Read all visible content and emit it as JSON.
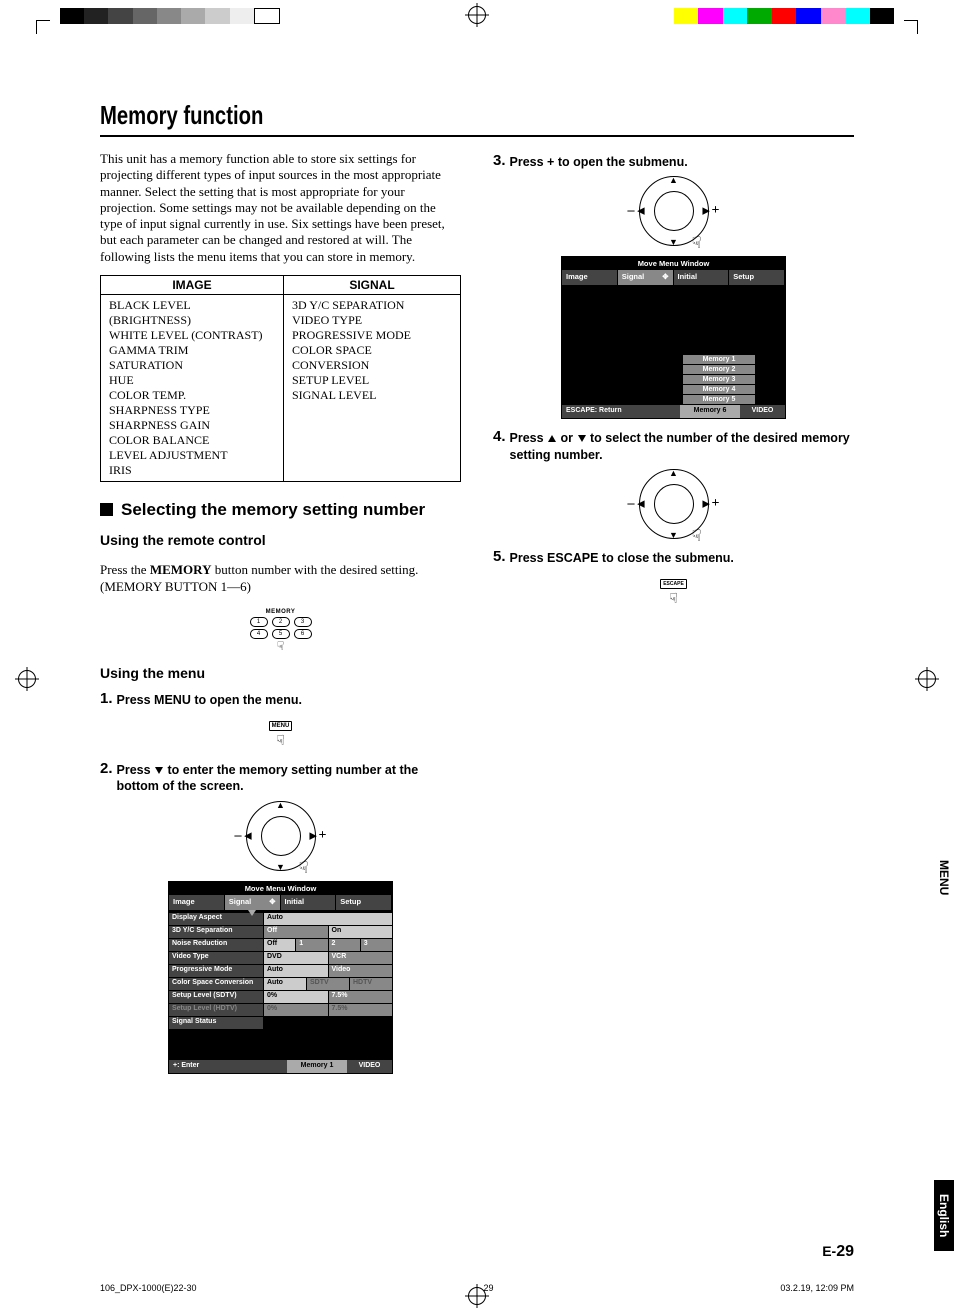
{
  "title": "Memory function",
  "intro": "This unit has a memory function able to store six settings for projecting different types of input sources in the most appropriate manner. Select the setting that is most appropriate for your projection. Some settings may not be available depending on the type of input signal currently in use. Six settings have been preset, but each parameter can be changed and restored at will. The following lists the menu items that you can store in memory.",
  "table": {
    "headers": [
      "IMAGE",
      "SIGNAL"
    ],
    "image_items": "BLACK LEVEL (BRIGHTNESS)\nWHITE LEVEL (CONTRAST)\nGAMMA TRIM\nSATURATION\nHUE\nCOLOR TEMP.\nSHARPNESS TYPE\nSHARPNESS GAIN\nCOLOR BALANCE\nLEVEL ADJUSTMENT\nIRIS",
    "signal_items": "3D Y/C SEPARATION\nVIDEO TYPE\nPROGRESSIVE MODE\nCOLOR SPACE CONVERSION\nSETUP LEVEL\nSIGNAL LEVEL"
  },
  "section1": "Selecting the memory setting number",
  "sub_remote": "Using the remote control",
  "remote_text_1": "Press the ",
  "remote_text_bold": "MEMORY",
  "remote_text_2": " button number with the desired setting.",
  "remote_text_3": "(MEMORY BUTTON 1—6)",
  "membtns_label": "MEMORY",
  "membtns": [
    "1",
    "2",
    "3",
    "4",
    "5",
    "6"
  ],
  "sub_menu": "Using the menu",
  "steps": {
    "s1": "Press MENU to open the menu.",
    "s2": "Press ▽ to enter the memory setting number at the bottom of the screen.",
    "s3": "Press + to open the submenu.",
    "s4a": "Press ",
    "s4b": " or ",
    "s4c": " to select the number of the desired memory setting number.",
    "s5": "Press ESCAPE to close the submenu."
  },
  "menu_label": "MENU",
  "escape_label": "ESCAPE",
  "osd": {
    "title": "Move Menu Window",
    "tabs": [
      "Image",
      "Signal",
      "Initial",
      "Setup"
    ],
    "rows": [
      {
        "label": "Display Aspect",
        "opts": [
          "Auto"
        ]
      },
      {
        "label": "3D Y/C Separation",
        "opts": [
          "Off",
          "On"
        ],
        "sel": 1
      },
      {
        "label": "Noise Reduction",
        "opts": [
          "Off",
          "1",
          "2",
          "3"
        ],
        "sel": 0
      },
      {
        "label": "Video Type",
        "opts": [
          "DVD",
          "VCR"
        ],
        "sel": 0
      },
      {
        "label": "Progressive Mode",
        "opts": [
          "Auto",
          "Video"
        ],
        "sel": 0
      },
      {
        "label": "Color Space Conversion",
        "opts": [
          "Auto",
          "SDTV",
          "HDTV"
        ],
        "sel": 0
      },
      {
        "label": "Setup Level (SDTV)",
        "opts": [
          "0%",
          "7.5%"
        ],
        "sel": 0
      },
      {
        "label": "Setup Level (HDTV)",
        "opts": [
          "0%",
          "7.5%"
        ],
        "sel": 0,
        "dim": true
      },
      {
        "label": "Signal Status",
        "opts": []
      }
    ],
    "footer_left": "+: Enter",
    "footer_mid": "Memory 1",
    "footer_right": "VIDEO"
  },
  "osd2": {
    "title": "Move Menu Window",
    "tabs": [
      "Image",
      "Signal",
      "Initial",
      "Setup"
    ],
    "memitems": [
      "Memory 1",
      "Memory 2",
      "Memory 3",
      "Memory 4",
      "Memory 5"
    ],
    "footer_left": "ESCAPE: Return",
    "footer_mid": "Memory 6",
    "footer_right": "VIDEO"
  },
  "side": {
    "menu": "MENU",
    "english": "English"
  },
  "pagenum_prefix": "E-",
  "pagenum": "29",
  "printfoot": {
    "left": "106_DPX-1000(E)22-30",
    "mid": "29",
    "right": "03.2.19, 12:09 PM"
  }
}
